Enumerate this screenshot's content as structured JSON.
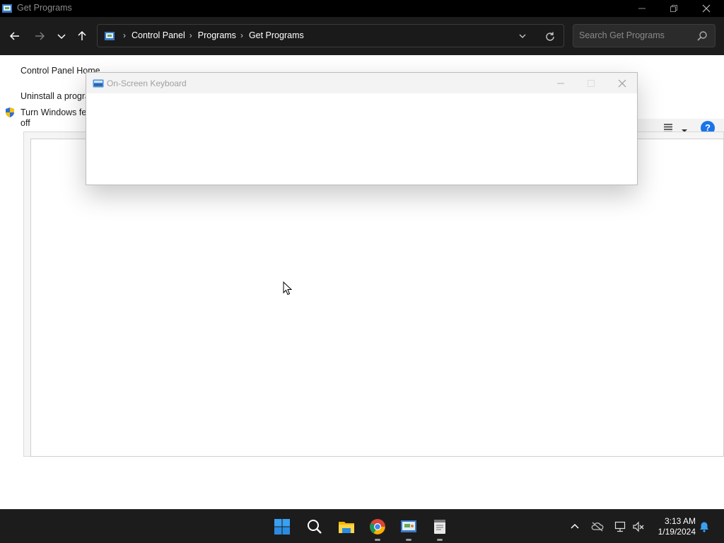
{
  "window": {
    "title": "Get Programs"
  },
  "address": {
    "breadcrumbs": [
      "Control Panel",
      "Programs",
      "Get Programs"
    ]
  },
  "search": {
    "placeholder": "Search Get Programs"
  },
  "sidebar": {
    "items": [
      {
        "label": "Control Panel Home"
      },
      {
        "label": "Uninstall a progra"
      },
      {
        "label": "Turn Windows fea"
      },
      {
        "label": "off"
      }
    ]
  },
  "help": {
    "label": "?"
  },
  "osk": {
    "title": "On-Screen Keyboard"
  },
  "taskbar": {
    "apps": [
      "start-icon",
      "search-icon",
      "file-explorer-icon",
      "chrome-icon",
      "control-panel-icon",
      "notepad-icon"
    ]
  },
  "tray": {
    "time": "3:13 AM",
    "date": "1/19/2024"
  },
  "colors": {
    "accent": "#1a73e8",
    "taskbar": "#1c1c1c",
    "titlebar": "#000000"
  }
}
